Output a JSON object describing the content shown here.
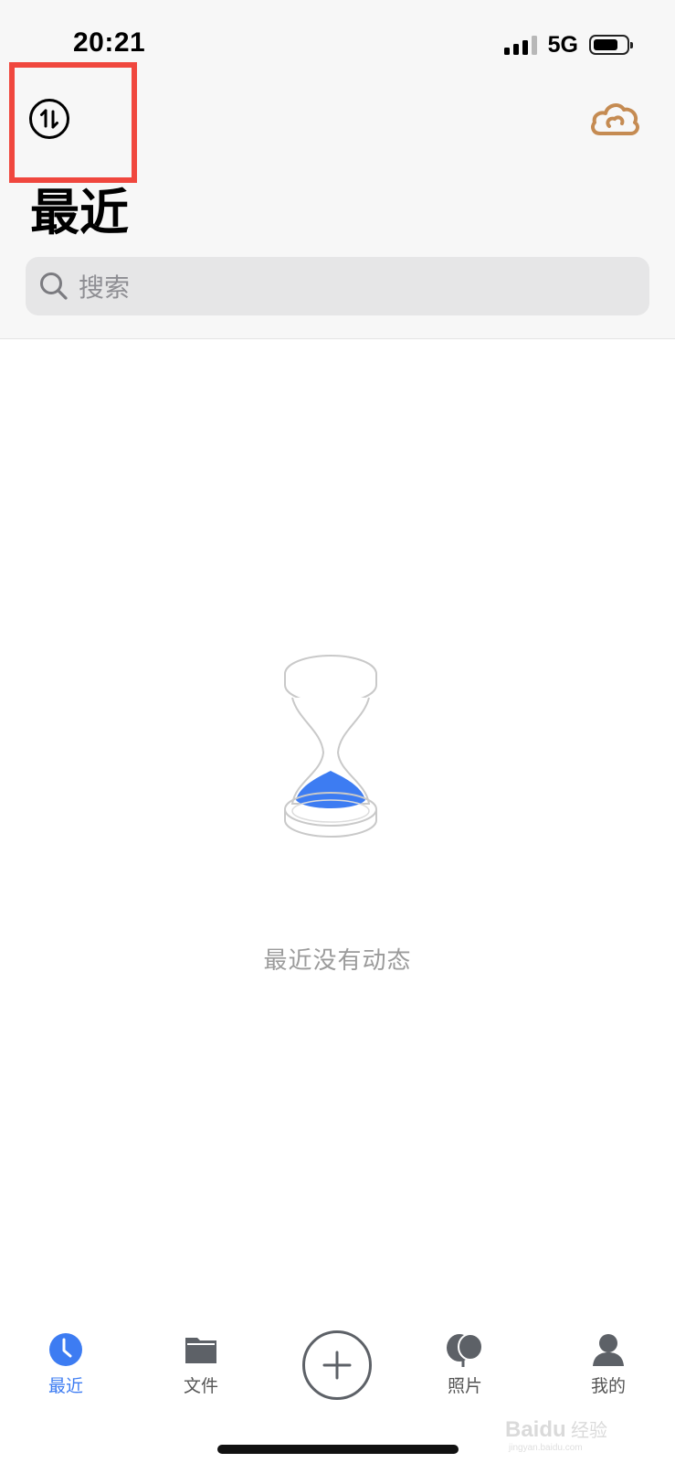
{
  "status_bar": {
    "time": "20:21",
    "network": "5G",
    "signal_bars": 4,
    "battery_icon": "battery-icon"
  },
  "header": {
    "title": "最近",
    "sort_icon": "sort-transfer-icon",
    "cloud_icon": "cloud-icon",
    "highlight_color": "#f0473e"
  },
  "search": {
    "placeholder": "搜索",
    "icon": "search-icon"
  },
  "empty_state": {
    "icon": "hourglass-icon",
    "message": "最近没有动态",
    "accent_color": "#3d7cf2"
  },
  "tabbar": {
    "items": [
      {
        "label": "最近",
        "icon": "clock-icon",
        "active": true
      },
      {
        "label": "文件",
        "icon": "folder-icon",
        "active": false
      },
      {
        "label": "",
        "icon": "add-icon",
        "active": false
      },
      {
        "label": "照片",
        "icon": "photos-icon",
        "active": false
      },
      {
        "label": "我的",
        "icon": "profile-icon",
        "active": false
      }
    ],
    "active_color": "#3d7cf2"
  },
  "watermark": {
    "text": "Baidu经验",
    "sub": "jingyan.baidu.com"
  }
}
